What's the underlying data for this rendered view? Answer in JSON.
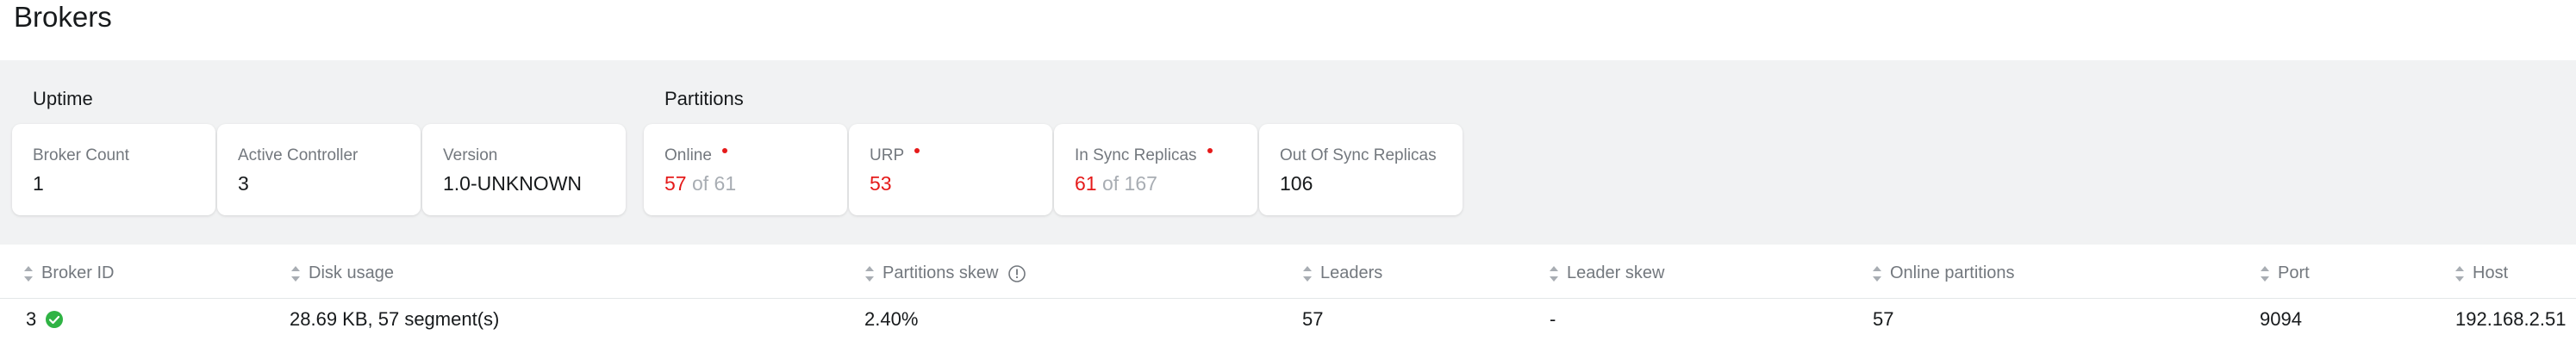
{
  "page": {
    "title": "Brokers"
  },
  "uptime": {
    "title": "Uptime",
    "cards": [
      {
        "label": "Broker Count",
        "value": "1"
      },
      {
        "label": "Active Controller",
        "value": "3"
      },
      {
        "label": "Version",
        "value": "1.0-UNKNOWN"
      }
    ]
  },
  "partitions": {
    "title": "Partitions",
    "cards": [
      {
        "label": "Online",
        "value": "57",
        "of": "of 61"
      },
      {
        "label": "URP",
        "value": "53"
      },
      {
        "label": "In Sync Replicas",
        "value": "61",
        "of": "of 167"
      },
      {
        "label": "Out Of Sync Replicas",
        "value": "106"
      }
    ]
  },
  "table": {
    "columns": [
      "Broker ID",
      "Disk usage",
      "Partitions skew",
      "Leaders",
      "Leader skew",
      "Online partitions",
      "Port",
      "Host"
    ],
    "rows": [
      [
        "3",
        "28.69 KB, 57 segment(s)",
        "2.40%",
        "57",
        "-",
        "57",
        "9094",
        "192.168.2.51"
      ]
    ]
  },
  "colors": {
    "alert": "#e51a1a",
    "ok": "#2fb344",
    "band": "#f1f2f3"
  }
}
